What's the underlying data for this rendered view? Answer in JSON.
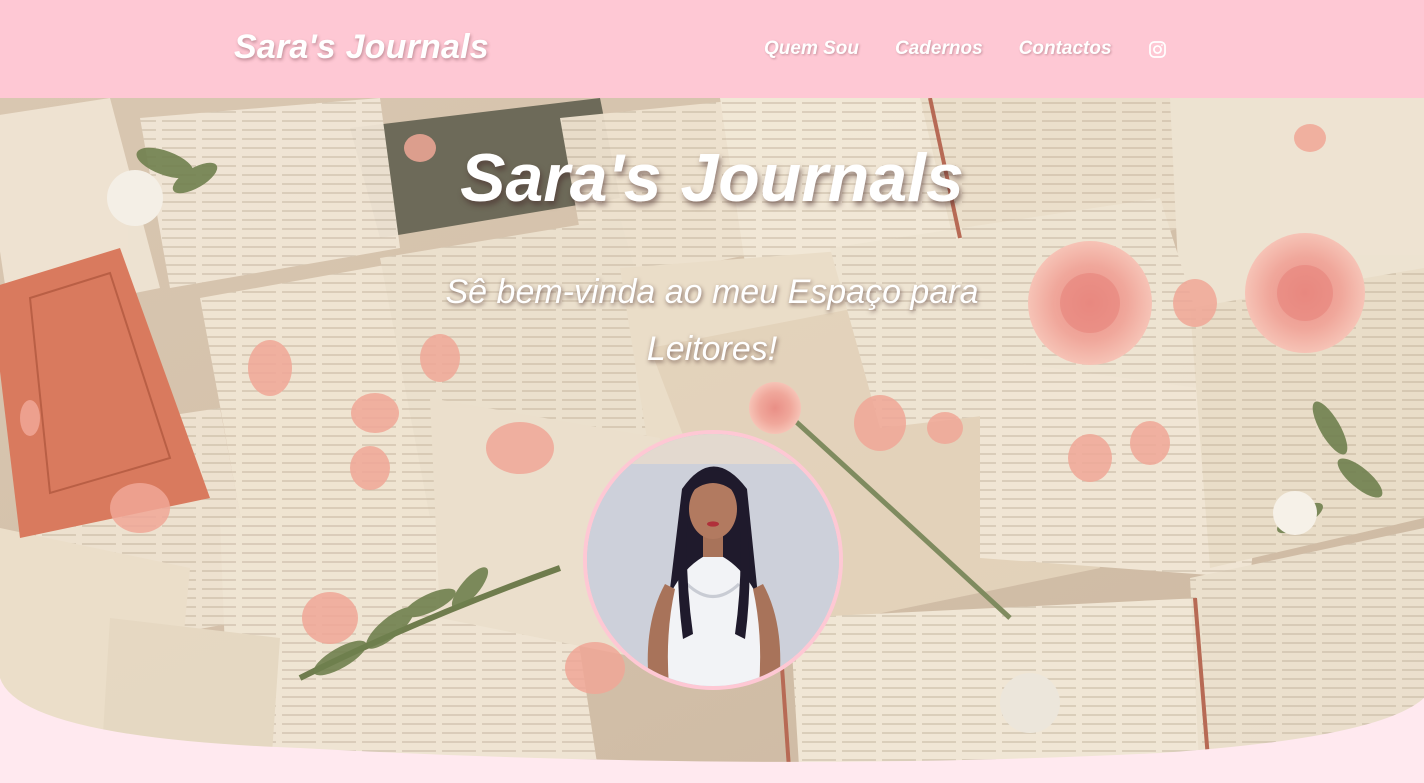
{
  "header": {
    "brand": "Sara's Journals",
    "nav": [
      {
        "label": "Quem Sou"
      },
      {
        "label": "Cadernos"
      },
      {
        "label": "Contactos"
      }
    ],
    "social_icon": "instagram-icon"
  },
  "hero": {
    "title": "Sara's Journals",
    "subtitle": "Sê bem-vinda ao meu Espaço para Leitores!"
  },
  "colors": {
    "header_bg": "#fec8d4",
    "page_bg": "#ffe9ef",
    "text": "#ffffff",
    "avatar_border": "#fec8d4"
  }
}
